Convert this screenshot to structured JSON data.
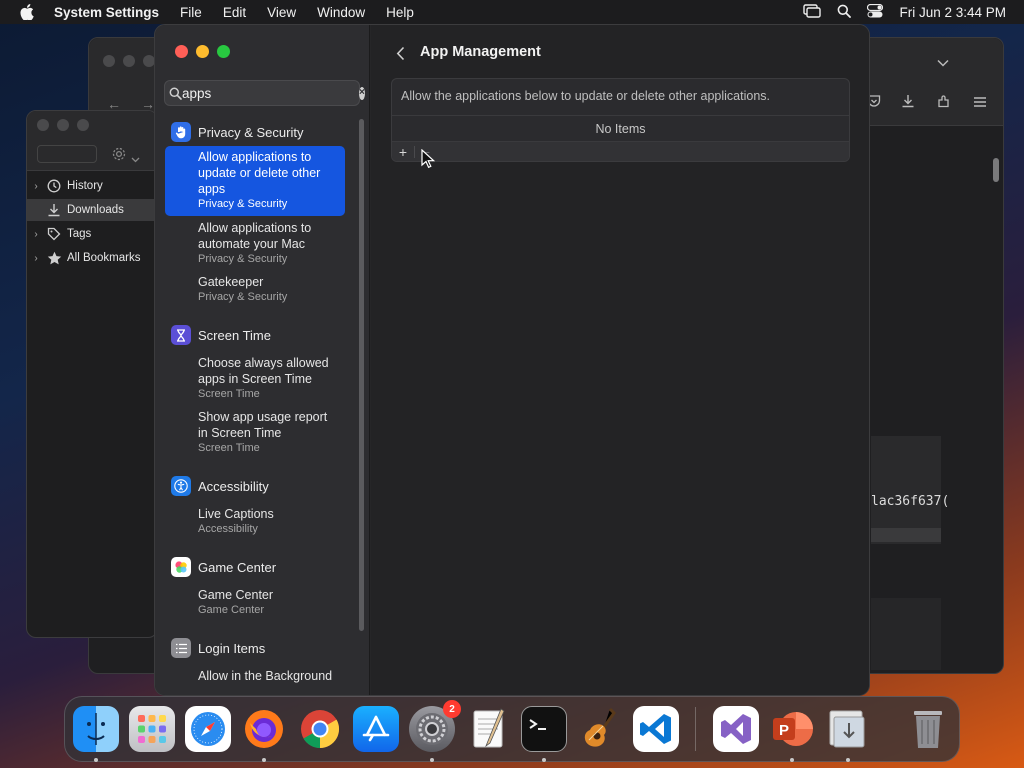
{
  "menubar": {
    "app_name": "System Settings",
    "items": [
      "File",
      "Edit",
      "View",
      "Window",
      "Help"
    ],
    "clock": "Fri Jun 2  3:44 PM"
  },
  "finder": {
    "items": [
      {
        "label": "History",
        "icon": "clock-icon"
      },
      {
        "label": "Downloads",
        "icon": "download-icon"
      },
      {
        "label": "Tags",
        "icon": "tag-icon"
      },
      {
        "label": "All Bookmarks",
        "icon": "star-icon"
      }
    ]
  },
  "background_terminal": {
    "hash_fragment": "lac36f637("
  },
  "settings": {
    "search": {
      "value": "apps",
      "placeholder": "Search"
    },
    "groups": [
      {
        "name": "Privacy & Security",
        "icon": "hand-icon",
        "color": "#2f6ee8",
        "results": [
          {
            "title": "Allow applications to update or delete other apps",
            "sub": "Privacy & Security",
            "selected": true
          },
          {
            "title": "Allow applications to automate your Mac",
            "sub": "Privacy & Security"
          },
          {
            "title": "Gatekeeper",
            "sub": "Privacy & Security"
          }
        ]
      },
      {
        "name": "Screen Time",
        "icon": "hourglass-icon",
        "color": "#5b4fd6",
        "results": [
          {
            "title": "Choose always allowed apps in Screen Time",
            "sub": "Screen Time"
          },
          {
            "title": "Show app usage report in Screen Time",
            "sub": "Screen Time"
          }
        ]
      },
      {
        "name": "Accessibility",
        "icon": "accessibility-icon",
        "color": "#1f7ae8",
        "results": [
          {
            "title": "Live Captions",
            "sub": "Accessibility"
          }
        ]
      },
      {
        "name": "Game Center",
        "icon": "game-center-icon",
        "color": "#ffffff",
        "results": [
          {
            "title": "Game Center",
            "sub": "Game Center"
          }
        ]
      },
      {
        "name": "Login Items",
        "icon": "list-icon",
        "color": "#8e8e93",
        "results": [
          {
            "title": "Allow in the Background",
            "sub": ""
          }
        ]
      }
    ],
    "content": {
      "title": "App Management",
      "description": "Allow the applications below to update or delete other applications.",
      "empty_text": "No Items",
      "add_label": "+",
      "remove_label": "−"
    }
  },
  "dock": {
    "apps": [
      {
        "name": "Finder",
        "icon": "finder-icon",
        "running": true
      },
      {
        "name": "Launchpad",
        "icon": "launchpad-icon",
        "running": false
      },
      {
        "name": "Safari",
        "icon": "safari-icon",
        "running": false
      },
      {
        "name": "Firefox",
        "icon": "firefox-icon",
        "running": true
      },
      {
        "name": "Chrome",
        "icon": "chrome-icon",
        "running": false
      },
      {
        "name": "App Store",
        "icon": "app-store-icon",
        "running": false
      },
      {
        "name": "System Settings",
        "icon": "system-settings-icon",
        "running": true,
        "badge": "2"
      },
      {
        "name": "TextEdit",
        "icon": "textedit-icon",
        "running": false
      },
      {
        "name": "Terminal",
        "icon": "terminal-icon",
        "running": true
      },
      {
        "name": "GarageBand",
        "icon": "garageband-icon",
        "running": false
      },
      {
        "name": "Visual Studio Code",
        "icon": "vscode-icon",
        "running": false
      },
      {
        "name": "Visual Studio",
        "icon": "visual-studio-icon",
        "running": false
      },
      {
        "name": "PowerPoint",
        "icon": "powerpoint-icon",
        "running": true
      },
      {
        "name": "Downloads",
        "icon": "downloads-stack-icon",
        "running": true
      },
      {
        "name": "Trash",
        "icon": "trash-icon",
        "running": false
      }
    ]
  }
}
